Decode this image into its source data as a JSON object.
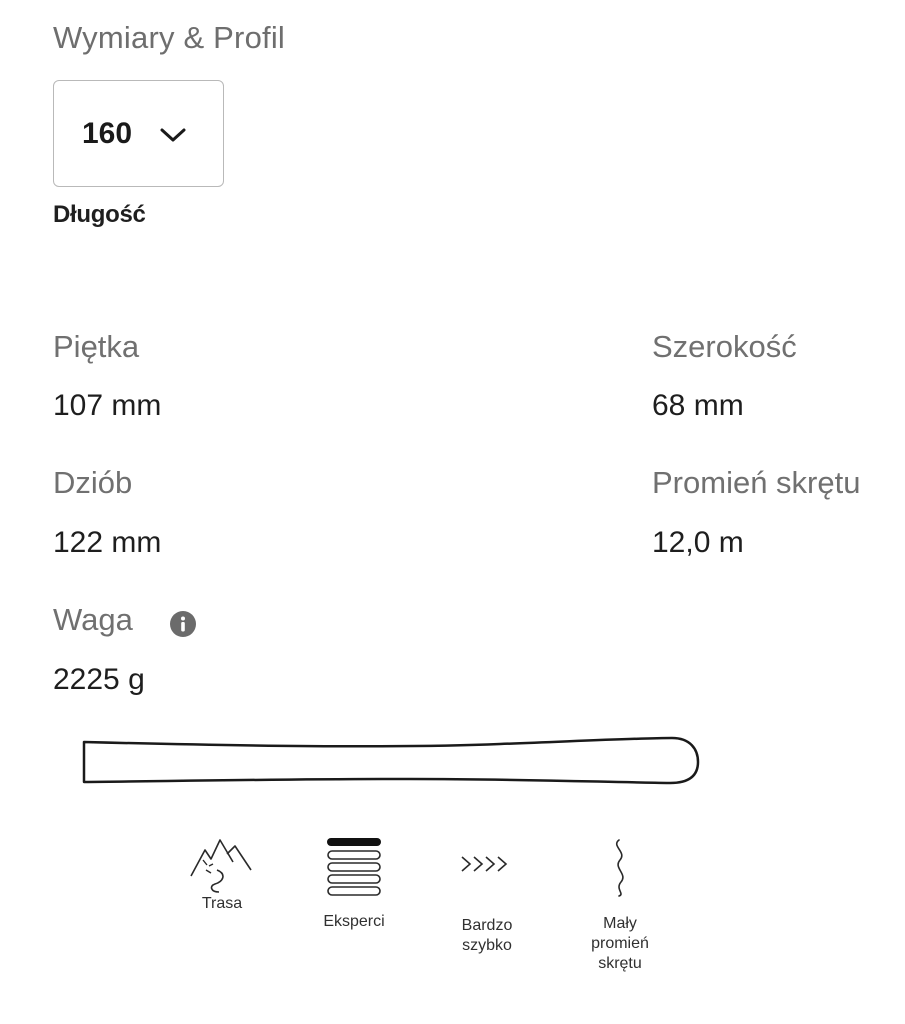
{
  "section": {
    "title": "Wymiary & Profil"
  },
  "length": {
    "selected": "160",
    "label": "Długość"
  },
  "specs": {
    "tail": {
      "label": "Piętka",
      "value": "107 mm"
    },
    "width": {
      "label": "Szerokość",
      "value": "68 mm"
    },
    "tip": {
      "label": "Dziób",
      "value": "122 mm"
    },
    "radius": {
      "label": "Promień skrętu",
      "value": "12,0 m"
    },
    "weight": {
      "label": "Waga",
      "value": "2225 g"
    }
  },
  "icons": {
    "info": "info-icon",
    "dropdown": "chevron-down-icon",
    "ski": "ski-profile-shape"
  },
  "features": [
    {
      "icon": "piste-mountain-icon",
      "label": "Trasa"
    },
    {
      "icon": "level-bars-icon",
      "label": "Eksperci"
    },
    {
      "icon": "speed-chevrons-icon",
      "label": "Bardzo\nszybko"
    },
    {
      "icon": "turn-radius-squiggle-icon",
      "label": "Mały\npromień\nskrętu"
    }
  ],
  "colors": {
    "label_gray": "#707070",
    "text_dark": "#1e1e1e",
    "border": "#b9b9b9",
    "info_icon": "#6b6b6b"
  }
}
